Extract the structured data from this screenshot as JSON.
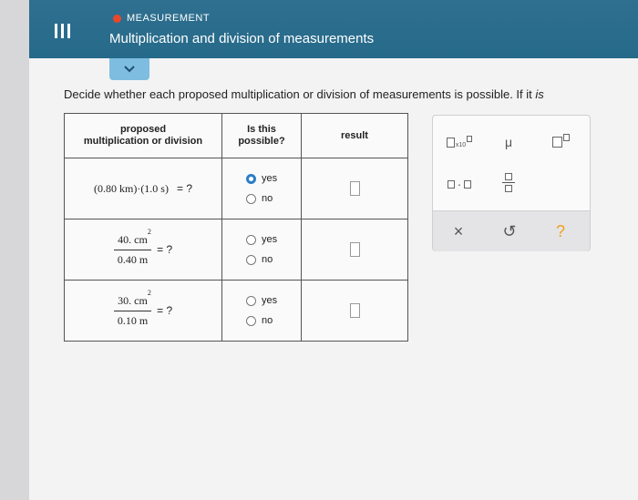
{
  "header": {
    "topic": "MEASUREMENT",
    "title": "Multiplication and division of measurements",
    "topic_dot_color": "#e8472b"
  },
  "instructions": {
    "main": "Decide whether each proposed multiplication or division of measurements is possible. If it",
    "cut_word": "is"
  },
  "table": {
    "headers": {
      "proposed_line1": "proposed",
      "proposed_line2": "multiplication or division",
      "possible_line1": "Is this",
      "possible_line2": "possible?",
      "result": "result"
    },
    "rows": [
      {
        "expr_a": "(0.80 km)",
        "dot": "·",
        "expr_b": "(1.0 s)",
        "eq": "= ?",
        "yes": "yes",
        "no": "no",
        "selected": "yes"
      },
      {
        "num": "40. cm",
        "num_exp": "2",
        "den": "0.40 m",
        "eq": "= ?",
        "yes": "yes",
        "no": "no",
        "selected": ""
      },
      {
        "num": "30. cm",
        "num_exp": "2",
        "den": "0.10 m",
        "eq": "= ?",
        "yes": "yes",
        "no": "no",
        "selected": ""
      }
    ]
  },
  "palette": {
    "times_ten_label": "x10",
    "mu": "μ",
    "dot_op": "·",
    "clear": "×",
    "undo": "↺",
    "help": "?",
    "help_color": "#f0a020"
  }
}
